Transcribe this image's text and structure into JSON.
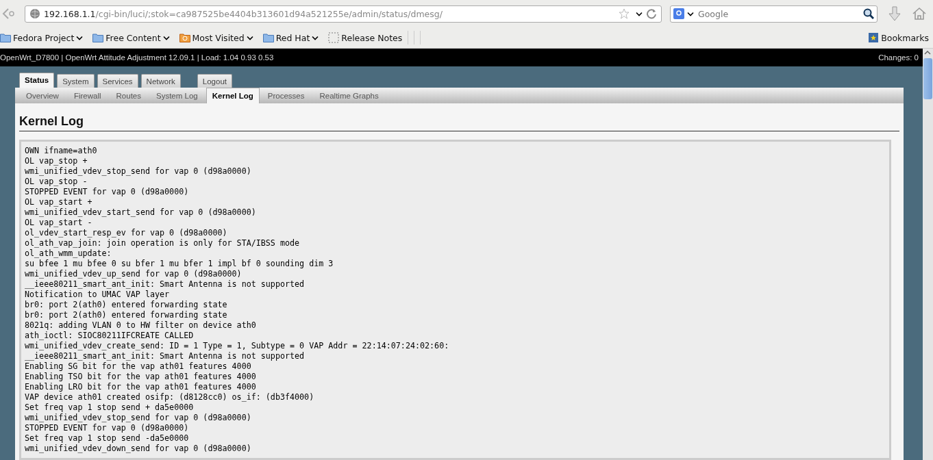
{
  "browser": {
    "url": {
      "host": "192.168.1.1",
      "path": "/cgi-bin/luci/;stok=ca987525be4404b313601d94a521255e/admin/status/dmesg/"
    },
    "search": {
      "placeholder": "Google"
    }
  },
  "bookmarks": [
    {
      "label": "Fedora Project",
      "kind": "folder",
      "dropdown": true
    },
    {
      "label": "Free Content",
      "kind": "folder",
      "dropdown": true
    },
    {
      "label": "Most Visited",
      "kind": "smart",
      "dropdown": true
    },
    {
      "label": "Red Hat",
      "kind": "folder",
      "dropdown": true
    },
    {
      "label": "Release Notes",
      "kind": "page",
      "dropdown": false
    }
  ],
  "bookmarks_menu": "Bookmarks",
  "header": {
    "title": "OpenWrt_D7800 | OpenWrt Attitude Adjustment 12.09.1 | Load: 1.04 0.93 0.53",
    "changes": "Changes: 0"
  },
  "tabs": [
    {
      "label": "Status",
      "selected": true
    },
    {
      "label": "System",
      "selected": false
    },
    {
      "label": "Services",
      "selected": false
    },
    {
      "label": "Network",
      "selected": false
    }
  ],
  "logout": "Logout",
  "subtabs": [
    {
      "label": "Overview",
      "selected": false
    },
    {
      "label": "Firewall",
      "selected": false
    },
    {
      "label": "Routes",
      "selected": false
    },
    {
      "label": "System Log",
      "selected": false
    },
    {
      "label": "Kernel Log",
      "selected": true
    },
    {
      "label": "Processes",
      "selected": false
    },
    {
      "label": "Realtime Graphs",
      "selected": false
    }
  ],
  "heading": "Kernel Log",
  "log": [
    "OWN ifname=ath0",
    "OL vap_stop +",
    "wmi_unified_vdev_stop_send for vap 0 (d98a0000)",
    "OL vap_stop -",
    "STOPPED EVENT for vap 0 (d98a0000)",
    "OL vap_start +",
    "wmi_unified_vdev_start_send for vap 0 (d98a0000)",
    "OL vap_start -",
    "ol_vdev_start_resp_ev for vap 0 (d98a0000)",
    "ol_ath_vap_join: join operation is only for STA/IBSS mode",
    "ol_ath_wmm_update:",
    "su bfee 1 mu bfee 0 su bfer 1 mu bfer 1 impl bf 0 sounding dim 3",
    "wmi_unified_vdev_up_send for vap 0 (d98a0000)",
    "__ieee80211_smart_ant_init: Smart Antenna is not supported",
    "Notification to UMAC VAP layer",
    "br0: port 2(ath0) entered forwarding state",
    "br0: port 2(ath0) entered forwarding state",
    "8021q: adding VLAN 0 to HW filter on device ath0",
    "ath_ioctl: SIOC80211IFCREATE CALLED",
    "wmi_unified_vdev_create_send: ID = 1 Type = 1, Subtype = 0 VAP Addr = 22:14:07:24:02:60:",
    "__ieee80211_smart_ant_init: Smart Antenna is not supported",
    "Enabling SG bit for the vap ath01 features 4000",
    "Enabling TSO bit for the vap ath01 features 4000",
    "Enabling LRO bit for the vap ath01 features 4000",
    "VAP device ath01 created osifp: (d8128cc0) os_if: (db3f4000)",
    "Set freq vap 1 stop send + da5e0000",
    "wmi_unified_vdev_stop_send for vap 0 (d98a0000)",
    "STOPPED EVENT for vap 0 (d98a0000)",
    "Set freq vap 1 stop send -da5e0000",
    "wmi_unified_vdev_down_send for vap 0 (d98a0000)"
  ]
}
